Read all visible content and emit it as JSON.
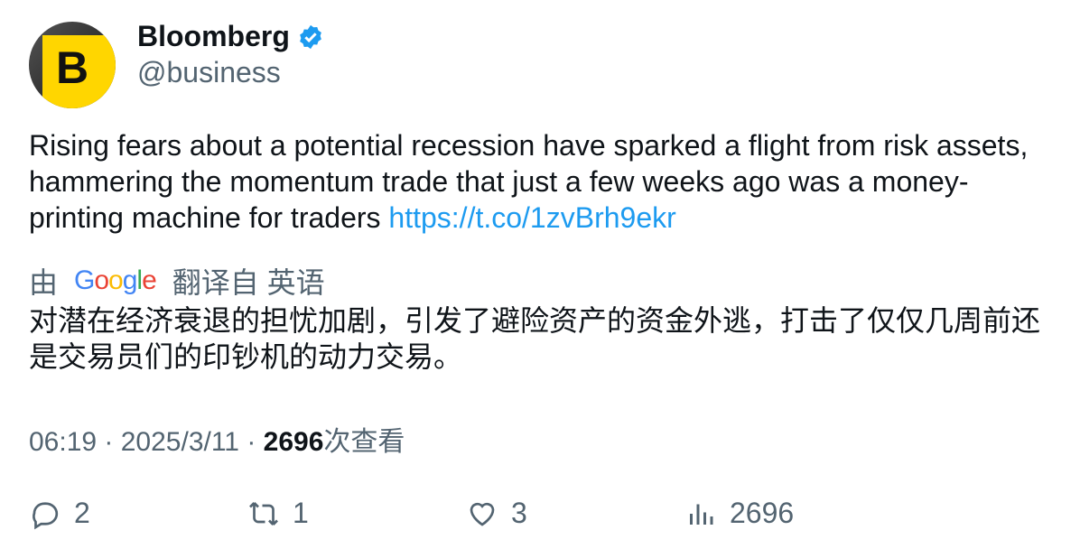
{
  "author": {
    "name": "Bloomberg",
    "handle": "@business",
    "avatar_letter": "B",
    "verified": true
  },
  "tweet": {
    "text": "Rising fears about a potential recession have sparked a flight from risk assets, hammering the momentum trade that just a few weeks ago was a money-printing machine for traders ",
    "link": "https://t.co/1zvBrh9ekr"
  },
  "translation": {
    "prefix": "由",
    "provider": "Google",
    "suffix": "翻译自 英语",
    "text": "对潜在经济衰退的担忧加剧，引发了避险资产的资金外逃，打击了仅仅几周前还是交易员们的印钞机的动力交易。"
  },
  "meta": {
    "time": "06:19",
    "sep": " · ",
    "date": "2025/3/11",
    "views": "2696",
    "views_label": "次查看"
  },
  "actions": {
    "replies": "2",
    "retweets": "1",
    "likes": "3",
    "views": "2696"
  }
}
